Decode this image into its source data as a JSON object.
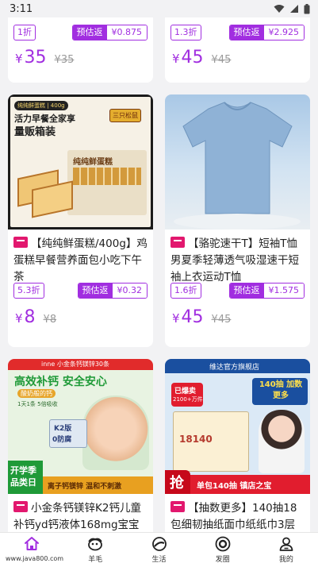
{
  "status": {
    "time": "3:11"
  },
  "cards": [
    {
      "id": "top-left",
      "title_partial": "",
      "discount": "1折",
      "rebate_label": "预估返",
      "rebate_value": "¥0.875",
      "currency": "¥",
      "price": "35",
      "old_price": "¥35"
    },
    {
      "id": "top-right",
      "discount": "1.3折",
      "rebate_label": "预估返",
      "rebate_value": "¥2.925",
      "currency": "¥",
      "price": "45",
      "old_price": "¥45"
    },
    {
      "id": "cake",
      "image_texts": {
        "badge": "纯纯鲜蛋糕 | 400g",
        "line1": "活力早餐全家享",
        "line2": "量贩箱装",
        "box": "纯纯鲜蛋糕",
        "brand": "三只松鼠"
      },
      "title": "【纯纯鲜蛋糕/400g】鸡蛋糕早餐营养面包小吃下午茶",
      "discount": "5.3折",
      "rebate_label": "预估返",
      "rebate_value": "¥0.32",
      "currency": "¥",
      "price": "8",
      "old_price": "¥8"
    },
    {
      "id": "tshirt",
      "title": "【骆驼速干T】短袖T恤男夏季轻薄透气吸湿速干短袖上衣运动T恤",
      "discount": "1.6折",
      "rebate_label": "预估返",
      "rebate_value": "¥1.575",
      "currency": "¥",
      "price": "45",
      "old_price": "¥45"
    },
    {
      "id": "calcium",
      "image_texts": {
        "brand_bar": "inne 小金条钙镁锌30条",
        "headline": "高效补钙  安全安心",
        "tag1": "酸奶般的钙",
        "tag2": "1天1条 5倍吸收",
        "k2a": "K2版",
        "k2b": "0防腐",
        "left_promo1": "开学季",
        "left_promo2": "品类日",
        "bottom": "离子钙镁锌  温和不刺激"
      },
      "title": "小金条钙镁锌K2钙儿童补钙yd钙液体168mg宝宝",
      "currency": "¥"
    },
    {
      "id": "tissue",
      "image_texts": {
        "store": "维达官方旗舰店",
        "promo": "140抽 加数更多",
        "badge1": "已爆卖",
        "badge2": "2100+万件",
        "qiang": "抢",
        "bottom": "单包140抽  镇店之宝",
        "pack": "18140"
      },
      "title": "【抽数更多】140抽18包细韧抽纸面巾纸纸巾3层",
      "currency": "¥"
    }
  ],
  "nav": [
    {
      "label": "",
      "icon": "home-icon"
    },
    {
      "label": "羊毛",
      "icon": "wool-icon"
    },
    {
      "label": "生活",
      "icon": "life-icon"
    },
    {
      "label": "发圈",
      "icon": "circle-icon"
    },
    {
      "label": "我的",
      "icon": "profile-icon"
    }
  ],
  "watermark": "www.java800.com",
  "colors": {
    "accent": "#a12ee0",
    "shop_tag": "#e2186e"
  }
}
